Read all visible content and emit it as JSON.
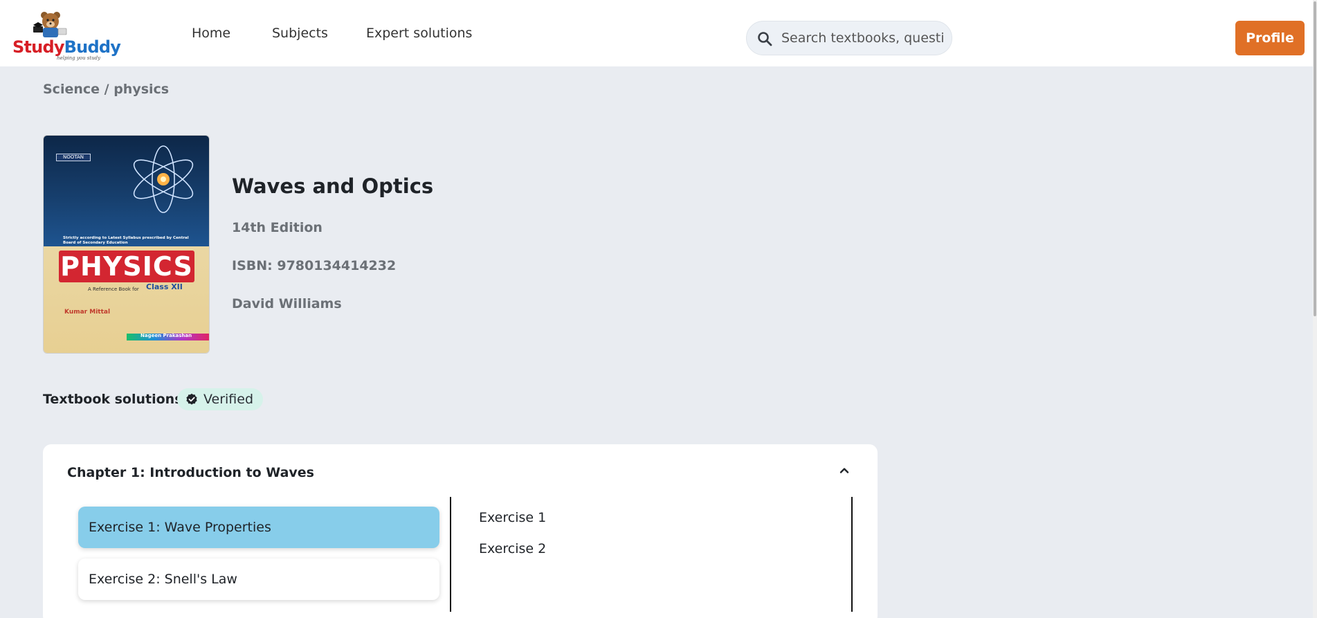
{
  "brand": {
    "name_part1": "Study",
    "name_part2": "Buddy",
    "tagline": "helping you study"
  },
  "nav": {
    "home": "Home",
    "subjects": "Subjects",
    "expert_solutions": "Expert solutions"
  },
  "search": {
    "placeholder": "Search textbooks, questions"
  },
  "profile_label": "Profile",
  "breadcrumb": "Science / physics",
  "book": {
    "title": "Waves and Optics",
    "edition": "14th Edition",
    "isbn": "ISBN: 9780134414232",
    "author": "David Williams",
    "cover": {
      "badge": "NOOTAN",
      "small_text": "Strictly according to Latest Syllabus prescribed by Central Board of Secondary Education",
      "title": "PHYSICS",
      "subtitle": "A Reference Book for",
      "class_label": "Class XII",
      "authors": "Kumar  Mittal",
      "publisher": "Nageen Prakashan"
    }
  },
  "solutions": {
    "label": "Textbook solutions",
    "verified_label": "Verified"
  },
  "chapter": {
    "title": "Chapter 1: Introduction to Waves",
    "exercises": [
      {
        "label": "Exercise 1: Wave Properties",
        "active": true
      },
      {
        "label": "Exercise 2: Snell's Law",
        "active": false
      }
    ],
    "sub_exercises": [
      "Exercise 1",
      "Exercise 2"
    ]
  },
  "colors": {
    "accent": "#e07026",
    "active_exercise": "#87cdea",
    "verified_bg": "#d6f2ea",
    "page_bg": "#e9ecf1"
  },
  "icons": [
    "search-icon",
    "verified-check-icon",
    "chevron-up-icon"
  ]
}
